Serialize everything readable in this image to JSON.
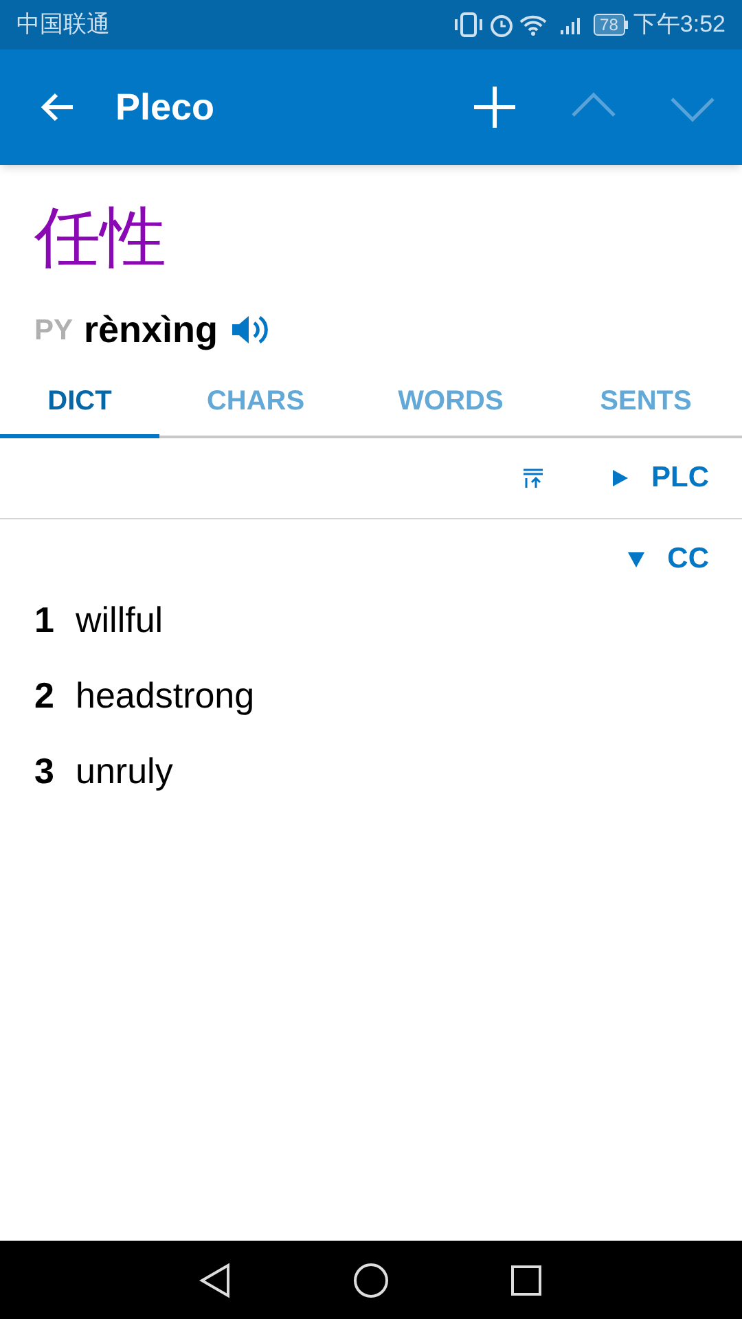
{
  "status_bar": {
    "carrier": "中国联通",
    "battery": "78",
    "time": "下午3:52"
  },
  "app_bar": {
    "title": "Pleco",
    "nav": [
      {
        "kind": "up",
        "disabled": true
      },
      {
        "kind": "down",
        "disabled": true
      }
    ]
  },
  "entry": {
    "headword": "任性",
    "pinyin_label": "PY",
    "pinyin": "rènxìng"
  },
  "tabs": [
    {
      "label": "DICT",
      "selected": true
    },
    {
      "label": "CHARS",
      "selected": false
    },
    {
      "label": "WORDS",
      "selected": false
    },
    {
      "label": "SENTS",
      "selected": false
    }
  ],
  "dictionaries": [
    {
      "name": "PLC",
      "expanded": false
    },
    {
      "name": "CC",
      "expanded": true,
      "definitions": [
        {
          "number": "1",
          "text": "willful"
        },
        {
          "number": "2",
          "text": "headstrong"
        },
        {
          "number": "3",
          "text": "unruly"
        }
      ]
    }
  ]
}
